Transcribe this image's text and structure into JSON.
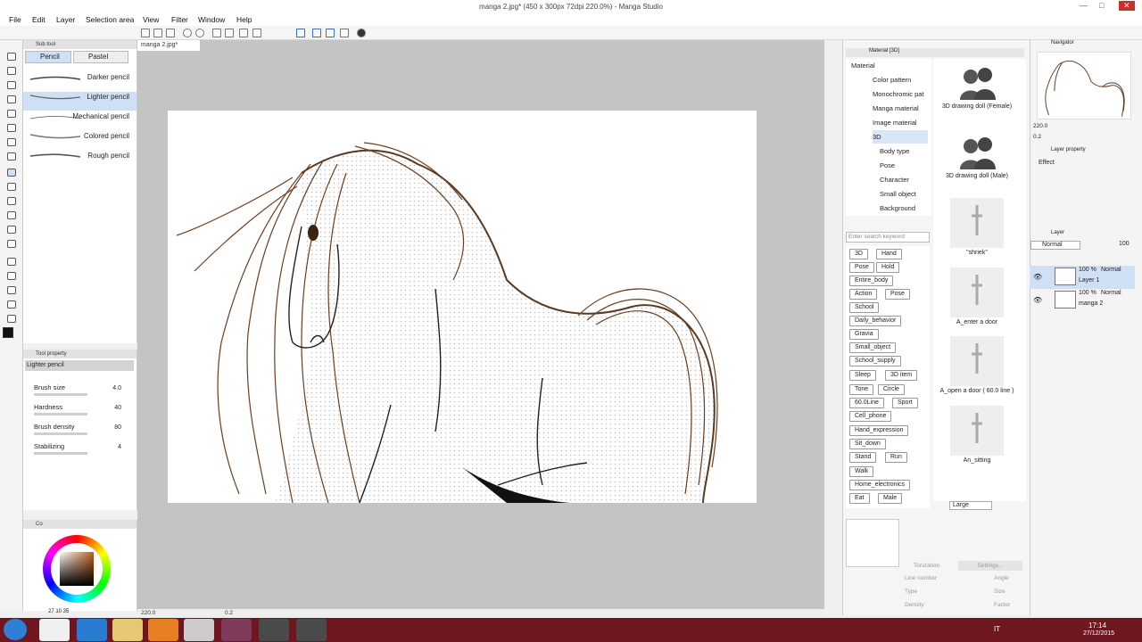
{
  "window": {
    "title": "manga 2.jpg* (450 x 300px 72dpi 220.0%) - Manga Studio",
    "min": "—",
    "max": "□",
    "close": "✕"
  },
  "menu": [
    "File",
    "Edit",
    "Layer",
    "Selection area",
    "View",
    "Filter",
    "Window",
    "Help"
  ],
  "subtool": {
    "header": "Sub tool",
    "tabs": [
      "Pencil",
      "Pastel"
    ],
    "brushes": [
      "Darker pencil",
      "Lighter pencil",
      "Mechanical pencil",
      "Colored pencil",
      "Rough pencil"
    ],
    "selected_brush": "Lighter pencil"
  },
  "tool_property": {
    "header": "Tool property",
    "name": "Lighter pencil",
    "rows": [
      {
        "label": "Brush size",
        "value": "4.0"
      },
      {
        "label": "Hardness",
        "value": "40"
      },
      {
        "label": "Brush density",
        "value": "80"
      },
      {
        "label": "Stabilizing",
        "value": "4"
      }
    ]
  },
  "color": {
    "header": "Co",
    "fg": "#111111",
    "readout": "27  10  35",
    "hue": "#8b4513"
  },
  "document": {
    "tab": "manga 2.jpg*",
    "zoom": "220.0",
    "angle": "0.2"
  },
  "material": {
    "header": "Material [3D]",
    "tree": [
      "Material",
      "Color pattern",
      "Monochromic pat",
      "Manga material",
      "Image material",
      "3D",
      "Body type",
      "Pose",
      "Character",
      "Small object",
      "Background"
    ],
    "selected": "3D",
    "search_placeholder": "Enter search keyword",
    "tags": [
      [
        "3D",
        "Hand"
      ],
      [
        "Pose",
        "Hold"
      ],
      [
        "Entire_body"
      ],
      [
        "Action",
        "Pose"
      ],
      [
        "School"
      ],
      [
        "Daily_behavior"
      ],
      [
        "Gravia"
      ],
      [
        "Small_object"
      ],
      [
        "School_supply"
      ],
      [
        "Sleep",
        "3D item"
      ],
      [
        "Tone",
        "Circle"
      ],
      [
        "60.0Line",
        "Sport"
      ],
      [
        "Cell_phone"
      ],
      [
        "Hand_expression"
      ],
      [
        "Sit_down"
      ],
      [
        "Stand",
        "Run"
      ],
      [
        "Walk"
      ],
      [
        "Home_electronics"
      ],
      [
        "Eat",
        "Male"
      ]
    ],
    "items": [
      "3D drawing doll (Female)",
      "3D drawing doll (Male)",
      "\"shriek\"",
      "A_enter a door",
      "A_open a door ( 60.0 line )",
      "An_sitting"
    ],
    "size_select": "Large",
    "props": {
      "tonization": "Tonization",
      "settings": "Settings...",
      "line_number": "Line number",
      "angle": "Angle",
      "type": "Type",
      "size": "Size",
      "density": "Density",
      "factor": "Factor"
    }
  },
  "navigator": {
    "header": "Navigator",
    "zoom": "220.0",
    "angle": "0.2"
  },
  "layer_property": {
    "header": "Layer property",
    "effect": "Effect"
  },
  "layers": {
    "header": "Layer",
    "blend": "Normal",
    "opacity": "100",
    "items": [
      {
        "opacity": "100 %",
        "mode": "Normal",
        "name": "Layer 1"
      },
      {
        "opacity": "100 %",
        "mode": "Normal",
        "name": "manga 2"
      }
    ]
  },
  "taskbar": {
    "lang": "IT",
    "time": "17:14",
    "date": "27/12/2015"
  }
}
